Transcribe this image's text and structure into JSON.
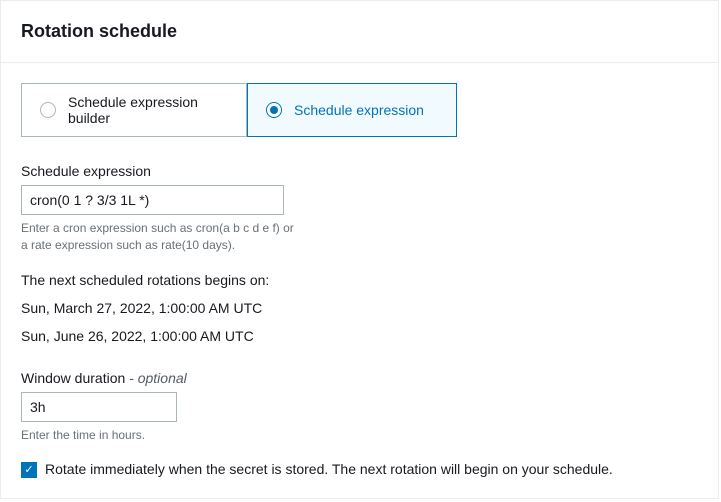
{
  "header": {
    "title": "Rotation schedule"
  },
  "tabs": {
    "builder": {
      "label": "Schedule expression builder"
    },
    "expression": {
      "label": "Schedule expression"
    }
  },
  "expressionField": {
    "label": "Schedule expression",
    "value": "cron(0 1 ? 3/3 1L *)",
    "helper": "Enter a cron expression such as cron(a b c d e f) or a rate expression such as rate(10 days)."
  },
  "nextRotation": {
    "heading": "The next scheduled rotations begins on:",
    "dates": [
      "Sun, March 27, 2022, 1:00:00 AM UTC",
      "Sun, June 26, 2022, 1:00:00 AM UTC"
    ]
  },
  "windowDuration": {
    "label": "Window duration",
    "optional": "- optional",
    "value": "3h",
    "helper": "Enter the time in hours."
  },
  "rotateImmediately": {
    "label": "Rotate immediately when the secret is stored. The next rotation will begin on your schedule."
  }
}
